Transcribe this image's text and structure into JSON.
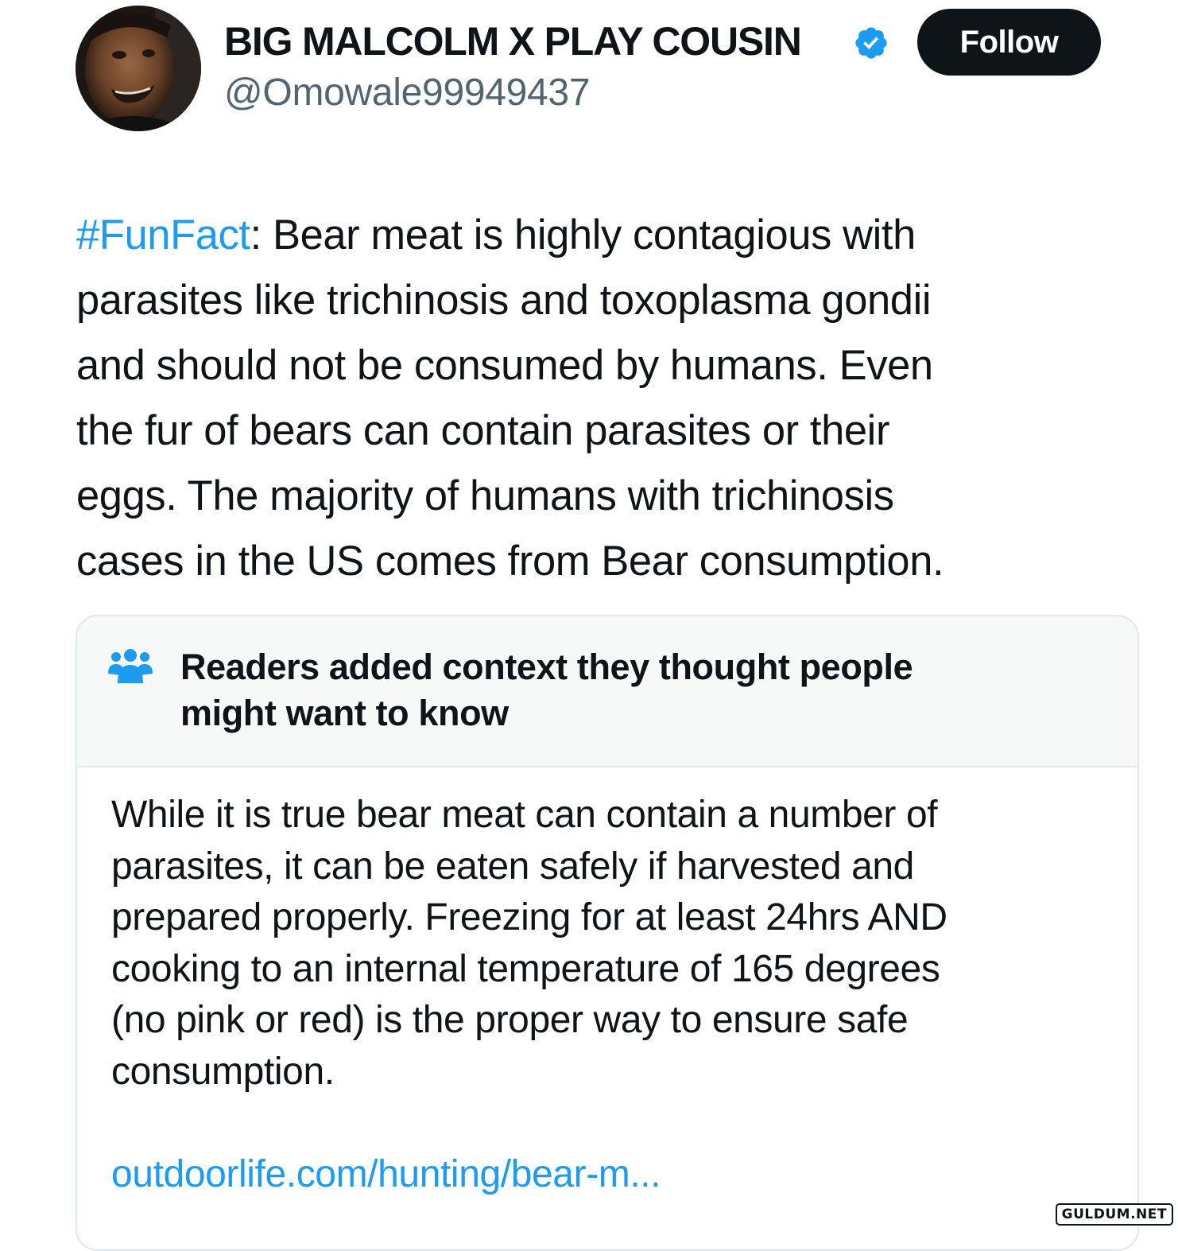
{
  "author": {
    "display_name": "BIG MALCOLM X PLAY COUSIN",
    "handle": "@Omowale99949437",
    "verified_badge": "verified-badge-icon",
    "follow_label": "Follow"
  },
  "tweet": {
    "hashtag": "#FunFact",
    "lines": [
      ": Bear meat is highly contagious with",
      "parasites like trichinosis and toxoplasma gondii",
      "and should not be consumed by humans. Even",
      "the fur of bears can contain parasites or their",
      "eggs. The majority of humans with trichinosis",
      "cases in the US comes from Bear consumption."
    ]
  },
  "community_note": {
    "icon": "people-icon",
    "title_lines": [
      "Readers added context they thought people",
      "might want to know"
    ],
    "body_lines": [
      "While it is true bear meat can contain a number of",
      "parasites, it can be eaten safely if harvested and",
      "prepared properly. Freezing for at least 24hrs AND",
      "cooking to an internal temperature of 165 degrees",
      "(no pink or red) is the proper way to ensure safe",
      "consumption."
    ],
    "link_text": "outdoorlife.com/hunting/bear-m..."
  },
  "watermark": "GULDUM.NET",
  "colors": {
    "accent": "#1d9bf0",
    "text": "#0f1419",
    "secondary_text": "#536471",
    "note_header_bg": "#f7f9f9",
    "border": "#e1e8ed"
  }
}
